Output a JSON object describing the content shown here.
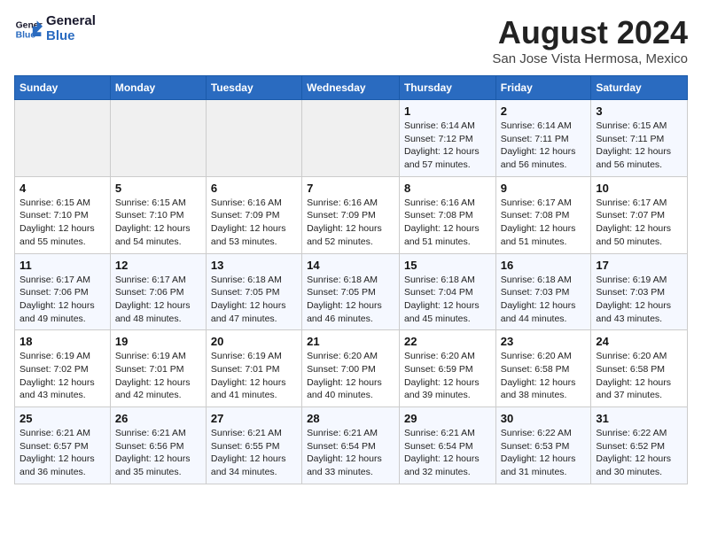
{
  "header": {
    "logo_line1": "General",
    "logo_line2": "Blue",
    "month_year": "August 2024",
    "location": "San Jose Vista Hermosa, Mexico"
  },
  "weekdays": [
    "Sunday",
    "Monday",
    "Tuesday",
    "Wednesday",
    "Thursday",
    "Friday",
    "Saturday"
  ],
  "weeks": [
    [
      {
        "day": "",
        "info": ""
      },
      {
        "day": "",
        "info": ""
      },
      {
        "day": "",
        "info": ""
      },
      {
        "day": "",
        "info": ""
      },
      {
        "day": "1",
        "info": "Sunrise: 6:14 AM\nSunset: 7:12 PM\nDaylight: 12 hours\nand 57 minutes."
      },
      {
        "day": "2",
        "info": "Sunrise: 6:14 AM\nSunset: 7:11 PM\nDaylight: 12 hours\nand 56 minutes."
      },
      {
        "day": "3",
        "info": "Sunrise: 6:15 AM\nSunset: 7:11 PM\nDaylight: 12 hours\nand 56 minutes."
      }
    ],
    [
      {
        "day": "4",
        "info": "Sunrise: 6:15 AM\nSunset: 7:10 PM\nDaylight: 12 hours\nand 55 minutes."
      },
      {
        "day": "5",
        "info": "Sunrise: 6:15 AM\nSunset: 7:10 PM\nDaylight: 12 hours\nand 54 minutes."
      },
      {
        "day": "6",
        "info": "Sunrise: 6:16 AM\nSunset: 7:09 PM\nDaylight: 12 hours\nand 53 minutes."
      },
      {
        "day": "7",
        "info": "Sunrise: 6:16 AM\nSunset: 7:09 PM\nDaylight: 12 hours\nand 52 minutes."
      },
      {
        "day": "8",
        "info": "Sunrise: 6:16 AM\nSunset: 7:08 PM\nDaylight: 12 hours\nand 51 minutes."
      },
      {
        "day": "9",
        "info": "Sunrise: 6:17 AM\nSunset: 7:08 PM\nDaylight: 12 hours\nand 51 minutes."
      },
      {
        "day": "10",
        "info": "Sunrise: 6:17 AM\nSunset: 7:07 PM\nDaylight: 12 hours\nand 50 minutes."
      }
    ],
    [
      {
        "day": "11",
        "info": "Sunrise: 6:17 AM\nSunset: 7:06 PM\nDaylight: 12 hours\nand 49 minutes."
      },
      {
        "day": "12",
        "info": "Sunrise: 6:17 AM\nSunset: 7:06 PM\nDaylight: 12 hours\nand 48 minutes."
      },
      {
        "day": "13",
        "info": "Sunrise: 6:18 AM\nSunset: 7:05 PM\nDaylight: 12 hours\nand 47 minutes."
      },
      {
        "day": "14",
        "info": "Sunrise: 6:18 AM\nSunset: 7:05 PM\nDaylight: 12 hours\nand 46 minutes."
      },
      {
        "day": "15",
        "info": "Sunrise: 6:18 AM\nSunset: 7:04 PM\nDaylight: 12 hours\nand 45 minutes."
      },
      {
        "day": "16",
        "info": "Sunrise: 6:18 AM\nSunset: 7:03 PM\nDaylight: 12 hours\nand 44 minutes."
      },
      {
        "day": "17",
        "info": "Sunrise: 6:19 AM\nSunset: 7:03 PM\nDaylight: 12 hours\nand 43 minutes."
      }
    ],
    [
      {
        "day": "18",
        "info": "Sunrise: 6:19 AM\nSunset: 7:02 PM\nDaylight: 12 hours\nand 43 minutes."
      },
      {
        "day": "19",
        "info": "Sunrise: 6:19 AM\nSunset: 7:01 PM\nDaylight: 12 hours\nand 42 minutes."
      },
      {
        "day": "20",
        "info": "Sunrise: 6:19 AM\nSunset: 7:01 PM\nDaylight: 12 hours\nand 41 minutes."
      },
      {
        "day": "21",
        "info": "Sunrise: 6:20 AM\nSunset: 7:00 PM\nDaylight: 12 hours\nand 40 minutes."
      },
      {
        "day": "22",
        "info": "Sunrise: 6:20 AM\nSunset: 6:59 PM\nDaylight: 12 hours\nand 39 minutes."
      },
      {
        "day": "23",
        "info": "Sunrise: 6:20 AM\nSunset: 6:58 PM\nDaylight: 12 hours\nand 38 minutes."
      },
      {
        "day": "24",
        "info": "Sunrise: 6:20 AM\nSunset: 6:58 PM\nDaylight: 12 hours\nand 37 minutes."
      }
    ],
    [
      {
        "day": "25",
        "info": "Sunrise: 6:21 AM\nSunset: 6:57 PM\nDaylight: 12 hours\nand 36 minutes."
      },
      {
        "day": "26",
        "info": "Sunrise: 6:21 AM\nSunset: 6:56 PM\nDaylight: 12 hours\nand 35 minutes."
      },
      {
        "day": "27",
        "info": "Sunrise: 6:21 AM\nSunset: 6:55 PM\nDaylight: 12 hours\nand 34 minutes."
      },
      {
        "day": "28",
        "info": "Sunrise: 6:21 AM\nSunset: 6:54 PM\nDaylight: 12 hours\nand 33 minutes."
      },
      {
        "day": "29",
        "info": "Sunrise: 6:21 AM\nSunset: 6:54 PM\nDaylight: 12 hours\nand 32 minutes."
      },
      {
        "day": "30",
        "info": "Sunrise: 6:22 AM\nSunset: 6:53 PM\nDaylight: 12 hours\nand 31 minutes."
      },
      {
        "day": "31",
        "info": "Sunrise: 6:22 AM\nSunset: 6:52 PM\nDaylight: 12 hours\nand 30 minutes."
      }
    ]
  ]
}
